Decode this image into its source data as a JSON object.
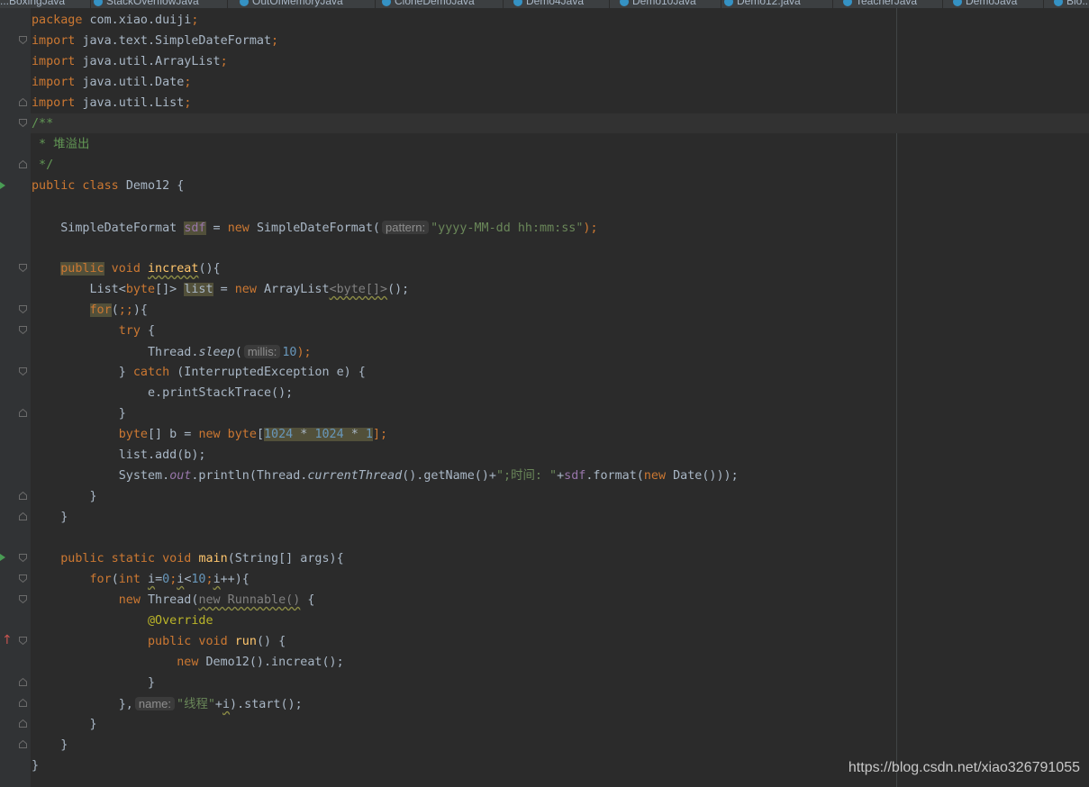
{
  "tabs": [
    {
      "label": "...BoxingJava"
    },
    {
      "label": "StackOverflowJava"
    },
    {
      "label": "OutOfMemoryJava"
    },
    {
      "label": "CloneDemoJava"
    },
    {
      "label": "Demo4Java"
    },
    {
      "label": "Demo10Java"
    },
    {
      "label": "Demo12.java",
      "active": true
    },
    {
      "label": "TeacherJava"
    },
    {
      "label": "DemoJava"
    },
    {
      "label": "Blo..."
    }
  ],
  "code": {
    "l1_a": "package ",
    "l1_b": "com.xiao.duiji",
    "l1_c": ";",
    "kw_import": "import ",
    "l2_b": "java.text.SimpleDateFormat",
    "l3_b": "java.util.ArrayList",
    "l4_b": "java.util.Date",
    "l5_b": "java.util.List",
    "semi": ";",
    "l6": "/**",
    "l7": " * 堆溢出",
    "l8": " */",
    "l9_a": "public class ",
    "l9_b": "Demo12 {",
    "l11_a": "    SimpleDateFormat ",
    "l11_b": "sdf",
    "l11_c": " = ",
    "l11_d": "new ",
    "l11_e": "SimpleDateFormat(",
    "l11_hint": "pattern:",
    "l11_str": "\"yyyy-MM-dd hh:mm:ss\"",
    "l11_f": ");",
    "l13_ind": "    ",
    "l13_a": "public",
    "l13_b": " void ",
    "l13_c": "increat",
    "l13_d": "(){",
    "l14_a": "        List<",
    "l14_b": "byte",
    "l14_c": "[]> ",
    "l14_d": "list",
    "l14_e": " = ",
    "l14_f": "new ",
    "l14_g": "ArrayList",
    "l14_h": "<byte[]>",
    "l14_i": "();",
    "l15_ind": "        ",
    "l15_a": "for",
    "l15_b": "(",
    "l15_c": ";;",
    "l15_d": "){",
    "l16_ind": "            ",
    "l16_a": "try",
    "l16_b": " {",
    "l17_a": "                Thread.",
    "l17_b": "sleep",
    "l17_c": "(",
    "l17_hint": "millis:",
    "l17_num": "10",
    "l17_d": ");",
    "l18_a": "            } ",
    "l18_b": "catch",
    "l18_c": " (InterruptedException e) {",
    "l19": "                e.printStackTrace();",
    "l20": "            }",
    "l21_ind": "            ",
    "l21_a": "byte",
    "l21_b": "[] b = ",
    "l21_c": "new byte",
    "l21_d": "[",
    "l21_e": "1024",
    "l21_f": " * ",
    "l21_g": "1024",
    "l21_h": " * ",
    "l21_i": "1",
    "l21_j": "];",
    "l22": "            list.add(b);",
    "l23_a": "            System.",
    "l23_b": "out",
    "l23_c": ".println(Thread.",
    "l23_d": "currentThread",
    "l23_e": "().getName()+",
    "l23_f": "\";时间: \"",
    "l23_g": "+",
    "l23_h": "sdf",
    "l23_i": ".format(",
    "l23_j": "new ",
    "l23_k": "Date()));",
    "l24": "        }",
    "l25": "    }",
    "l27_a": "    public static void ",
    "l27_b": "main",
    "l27_c": "(String[] args){",
    "l28_ind": "        ",
    "l28_a": "for",
    "l28_b": "(",
    "l28_c": "int ",
    "l28_d": "i",
    "l28_e": "=",
    "l28_f": "0",
    "l28_g": ";",
    "l28_h": "i",
    "l28_i": "<",
    "l28_j": "10",
    "l28_k": ";",
    "l28_l": "i",
    "l28_m": "++){",
    "l29_ind": "            ",
    "l29_a": "new ",
    "l29_b": "Thread(",
    "l29_c": "new Runnable()",
    "l29_d": " {",
    "l30_ind": "                ",
    "l30_a": "@Override",
    "l31_ind": "                ",
    "l31_a": "public void ",
    "l31_b": "run",
    "l31_c": "() {",
    "l32_ind": "                    ",
    "l32_a": "new ",
    "l32_b": "Demo12().increat();",
    "l33": "                }",
    "l34_a": "            },",
    "l34_hint": "name:",
    "l34_str": "\"线程\"",
    "l34_b": "+",
    "l34_c": "i",
    "l34_d": ").start();",
    "l35": "        }",
    "l36": "    }",
    "l37": "}"
  },
  "watermark": "https://blog.csdn.net/xiao326791055",
  "colors": {
    "background": "#2b2b2b",
    "keyword": "#cc7832",
    "string": "#6a8759",
    "number": "#6897bb",
    "method": "#ffc66d",
    "field": "#9876aa"
  }
}
